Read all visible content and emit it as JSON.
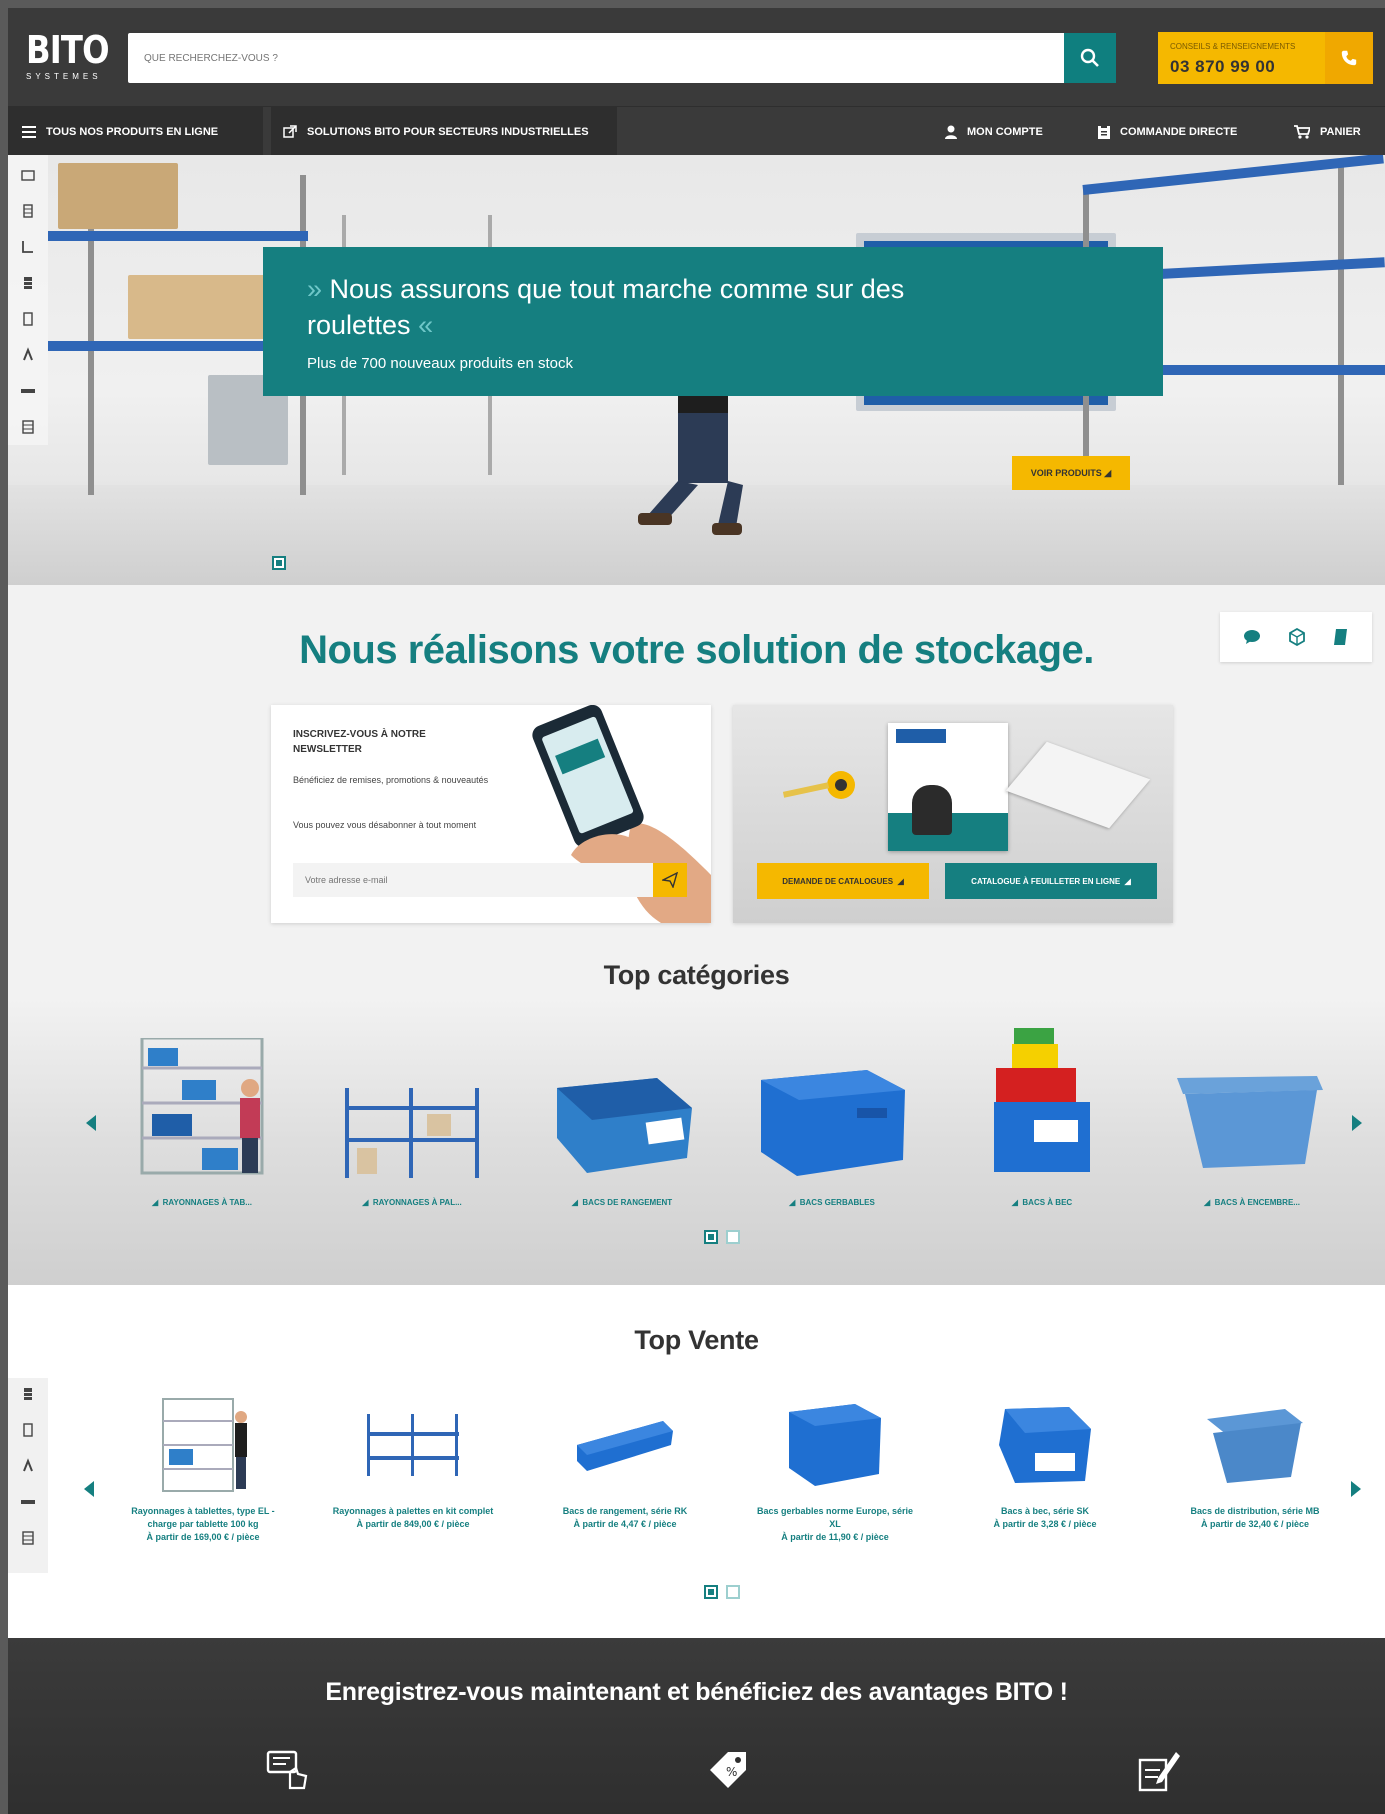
{
  "header": {
    "logo_text": "BITO",
    "logo_sub": "SYSTEMES",
    "search_placeholder": "QUE RECHERCHEZ-VOUS ?",
    "contact_label": "CONSEILS & RENSEIGNEMENTS",
    "contact_phone": "03 870 99 00"
  },
  "nav": {
    "products": "TOUS NOS PRODUITS EN LIGNE",
    "solutions": "SOLUTIONS BITO POUR SECTEURS INDUSTRIELLES",
    "account": "MON COMPTE",
    "direct_order": "COMMANDE DIRECTE",
    "cart": "PANIER"
  },
  "hero": {
    "title_line": "Nous assurons que tout marche comme sur des roulettes",
    "quote_open": "»",
    "quote_close": "«",
    "subtitle": "Plus de 700 nouveaux produits en stock",
    "cta": "VOIR PRODUITS"
  },
  "main_title": "Nous réalisons votre solution de stockage.",
  "newsletter": {
    "heading": "INSCRIVEZ-VOUS À NOTRE NEWSLETTER",
    "text1": "Bénéficiez de remises, promotions & nouveautés",
    "text2": "Vous pouvez vous désabonner à tout moment",
    "email_placeholder": "Votre adresse e-mail"
  },
  "catalog": {
    "btn_request": "DEMANDE DE CATALOGUES",
    "btn_flip": "CATALOGUE À FEUILLETER EN LIGNE"
  },
  "top_categories": {
    "title": "Top catégories",
    "items": [
      {
        "label": "RAYONNAGES À TAB..."
      },
      {
        "label": "RAYONNAGES À PAL..."
      },
      {
        "label": "BACS DE RANGEMENT"
      },
      {
        "label": "BACS GERBABLES"
      },
      {
        "label": "BACS À BEC"
      },
      {
        "label": "BACS À ENCEMBRE..."
      }
    ]
  },
  "top_vente": {
    "title": "Top Vente",
    "items": [
      {
        "name": "Rayonnages à tablettes, type EL - charge par tablette 100 kg",
        "price": "À partir de 169,00 € / pièce"
      },
      {
        "name": "Rayonnages à palettes en kit complet",
        "price": "À partir de 849,00 € / pièce"
      },
      {
        "name": "Bacs de rangement, série RK",
        "price": "À partir de 4,47 € / pièce"
      },
      {
        "name": "Bacs gerbables norme Europe, série XL",
        "price": "À partir de 11,90 € / pièce"
      },
      {
        "name": "Bacs à bec, série SK",
        "price": "À partir de 3,28 € / pièce"
      },
      {
        "name": "Bacs de distribution, série MB",
        "price": "À partir de 32,40 € / pièce"
      }
    ]
  },
  "register": {
    "title": "Enregistrez-vous maintenant et bénéficiez des avantages BITO !"
  },
  "colors": {
    "teal": "#157f80",
    "yellow": "#f5b800",
    "dark": "#3a3a3a",
    "blue": "#2f66b6"
  },
  "icons": [
    "search-icon",
    "phone-icon",
    "menu-icon",
    "external-link-icon",
    "user-icon",
    "clipboard-icon",
    "cart-icon",
    "chat-icon",
    "cube-icon",
    "book-icon",
    "send-icon",
    "hand-click-icon",
    "tag-icon",
    "edit-icon"
  ]
}
